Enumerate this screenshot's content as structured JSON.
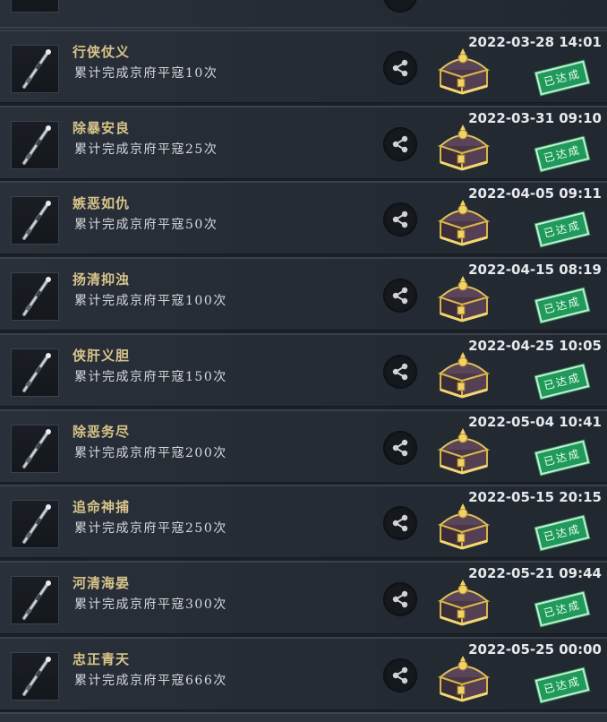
{
  "achievements": [
    {
      "title": "行侠仗义",
      "desc": "累计完成京府平寇10次",
      "date": "2022-03-28 14:01",
      "status": "已达成"
    },
    {
      "title": "除暴安良",
      "desc": "累计完成京府平寇25次",
      "date": "2022-03-31 09:10",
      "status": "已达成"
    },
    {
      "title": "嫉恶如仇",
      "desc": "累计完成京府平寇50次",
      "date": "2022-04-05 09:11",
      "status": "已达成"
    },
    {
      "title": "扬清抑浊",
      "desc": "累计完成京府平寇100次",
      "date": "2022-04-15 08:19",
      "status": "已达成"
    },
    {
      "title": "侠肝义胆",
      "desc": "累计完成京府平寇150次",
      "date": "2022-04-25 10:05",
      "status": "已达成"
    },
    {
      "title": "除恶务尽",
      "desc": "累计完成京府平寇200次",
      "date": "2022-05-04 10:41",
      "status": "已达成"
    },
    {
      "title": "追命神捕",
      "desc": "累计完成京府平寇250次",
      "date": "2022-05-15 20:15",
      "status": "已达成"
    },
    {
      "title": "河清海晏",
      "desc": "累计完成京府平寇300次",
      "date": "2022-05-21 09:44",
      "status": "已达成"
    },
    {
      "title": "忠正青天",
      "desc": "累计完成京府平寇666次",
      "date": "2022-05-25 00:00",
      "status": "已达成"
    }
  ],
  "icons": {
    "share": "share-icon",
    "chest": "treasure-chest-icon",
    "item": "weapon-staff-icon"
  },
  "colors": {
    "title": "#d8c48a",
    "stamp": "#1f9a5a",
    "row_bg": "#262c35"
  }
}
